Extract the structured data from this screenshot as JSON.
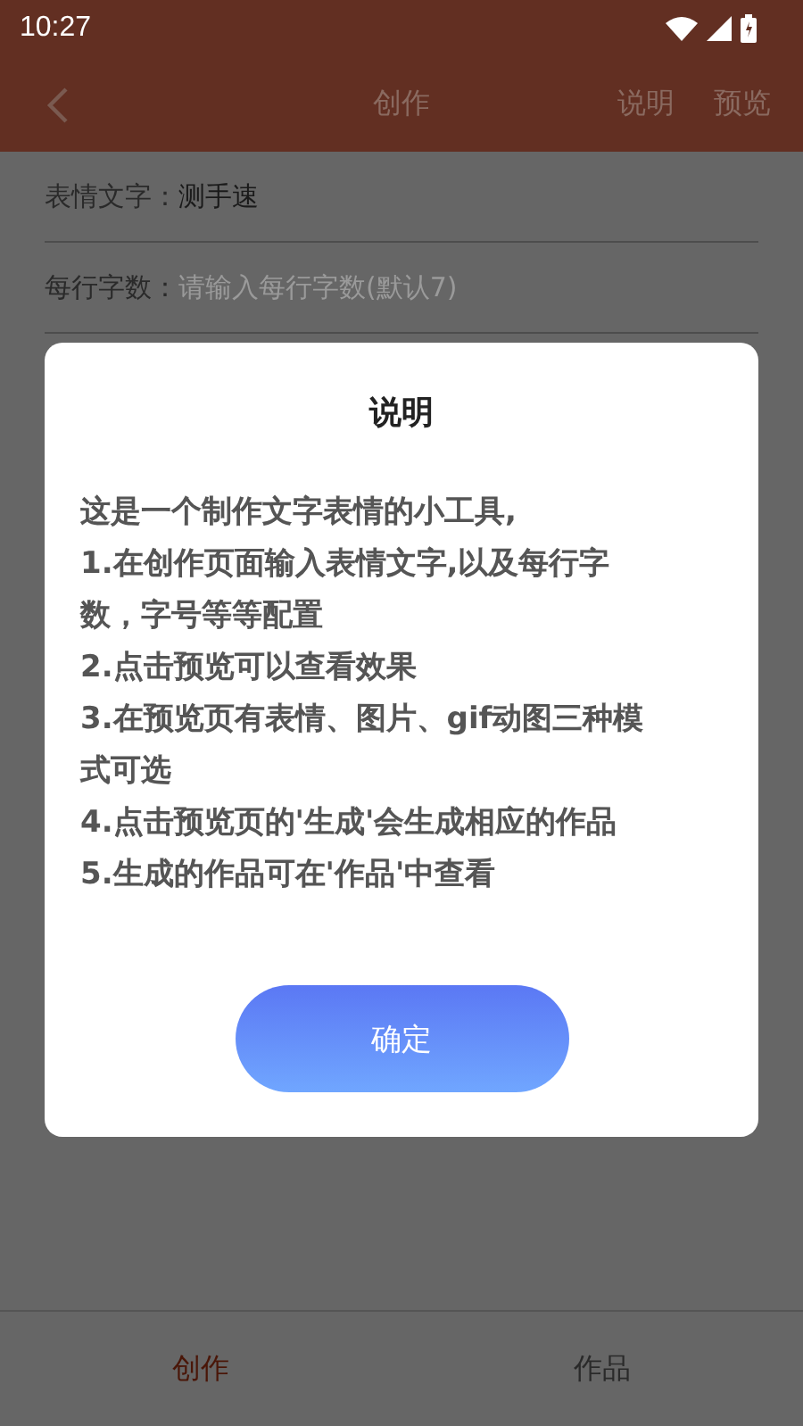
{
  "status_bar": {
    "time": "10:27"
  },
  "header": {
    "title": "创作",
    "actions": [
      "说明",
      "预览"
    ]
  },
  "form": [
    {
      "kind": "value",
      "label": "表情文字：",
      "value": "测手速"
    },
    {
      "kind": "input",
      "label": "每行字数：",
      "placeholder": "请输入每行字数(默认7)"
    }
  ],
  "dialog": {
    "title": "说明",
    "lines": [
      "这是一个制作文字表情的小工具,",
      "1.在创作页面输入表情文字,以及每行字数，字号等等配置",
      "2.点击预览可以查看效果",
      "3.在预览页有表情、图片、gif动图三种模式可选",
      "4.点击预览页的'生成'会生成相应的作品",
      "5.生成的作品可在'作品'中查看"
    ],
    "button": "确定"
  },
  "bottom_tabs": [
    {
      "label": "创作",
      "selected": true
    },
    {
      "label": "作品",
      "selected": false
    }
  ]
}
